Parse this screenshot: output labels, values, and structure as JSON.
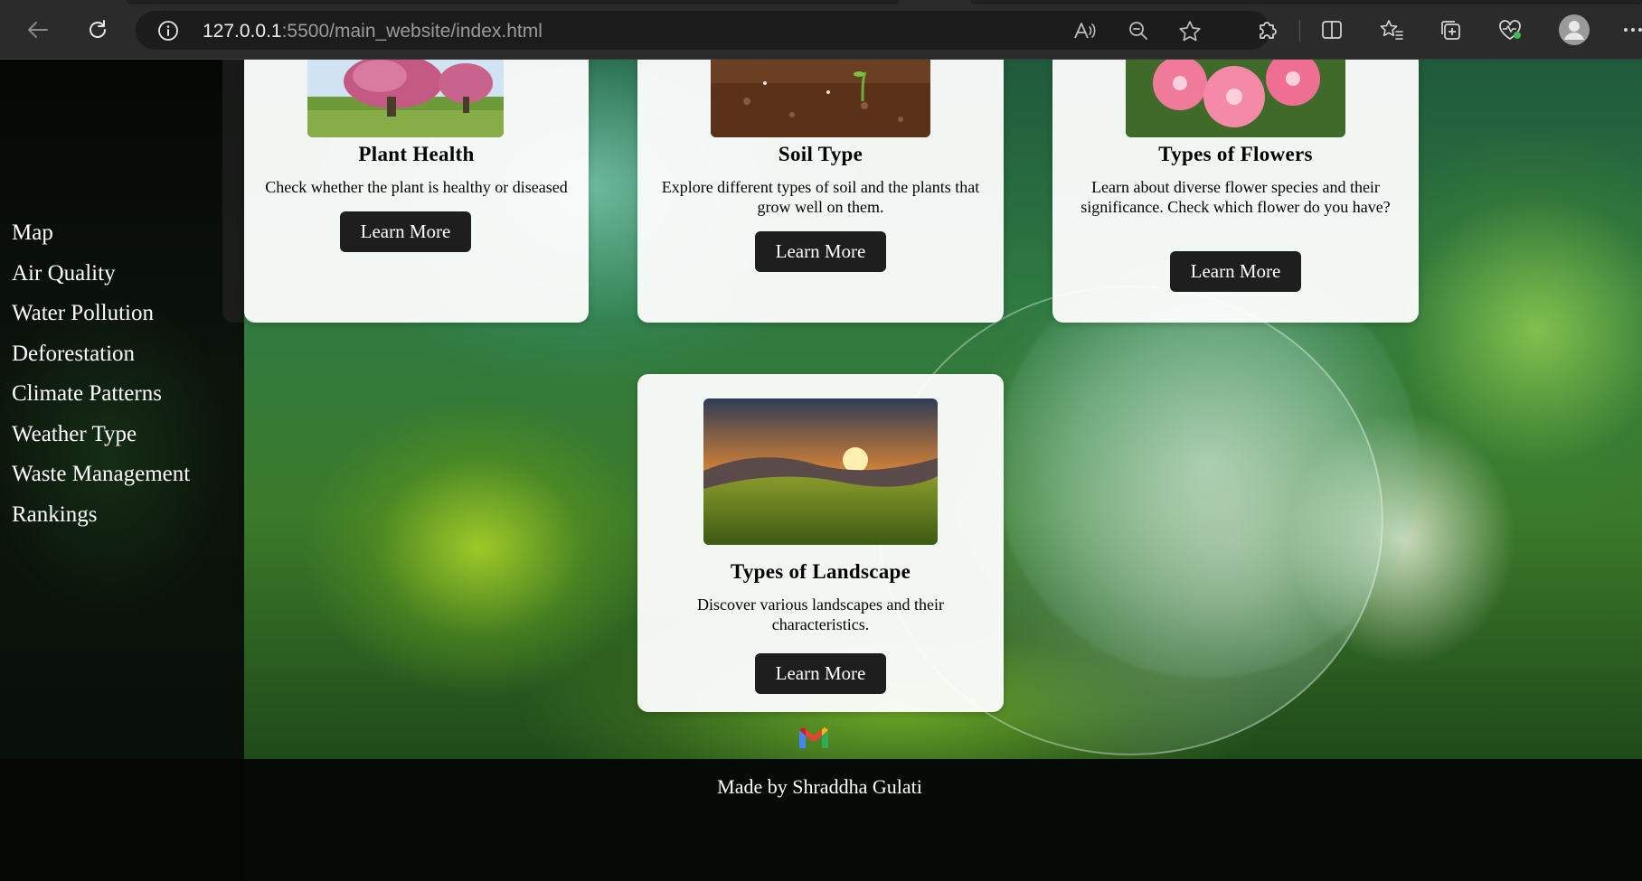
{
  "browser": {
    "url_host": "127.0.0.1",
    "url_rest": ":5500/main_website/index.html",
    "icons": [
      "back-icon",
      "refresh-icon",
      "info-icon",
      "read-aloud-icon",
      "zoom-out-icon",
      "favorite-star-icon",
      "extensions-icon",
      "split-screen-icon",
      "favorites-icon",
      "collections-icon",
      "browser-essentials-icon",
      "profile-avatar-icon",
      "more-icon"
    ]
  },
  "sidebar": {
    "items": [
      {
        "label": "Map"
      },
      {
        "label": "Air Quality"
      },
      {
        "label": "Water Pollution"
      },
      {
        "label": "Deforestation"
      },
      {
        "label": "Climate Patterns"
      },
      {
        "label": "Weather Type"
      },
      {
        "label": "Waste Management"
      },
      {
        "label": "Rankings"
      }
    ]
  },
  "cards": [
    {
      "title": "Plant Health",
      "description": "Check whether the plant is healthy or diseased",
      "button": "Learn More",
      "image": "blossom-tree-image"
    },
    {
      "title": "Soil Type",
      "description": "Explore different types of soil and the plants that grow well on them.",
      "button": "Learn More",
      "image": "soil-sprout-image"
    },
    {
      "title": "Types of Flowers",
      "description": "Learn about diverse flower species and their significance. Check which flower do you have?",
      "button": "Learn More",
      "image": "pink-flowers-image"
    },
    {
      "title": "Types of Landscape",
      "description": "Discover various landscapes and their characteristics.",
      "button": "Learn More",
      "image": "sunset-hills-image"
    }
  ],
  "footer": {
    "icon": "gmail-icon",
    "credit": "Made by Shraddha Gulati"
  },
  "colors": {
    "chrome_bg": "#2b2b2b",
    "button_bg": "#1e1e1e",
    "sidebar_text": "#ffffff"
  }
}
